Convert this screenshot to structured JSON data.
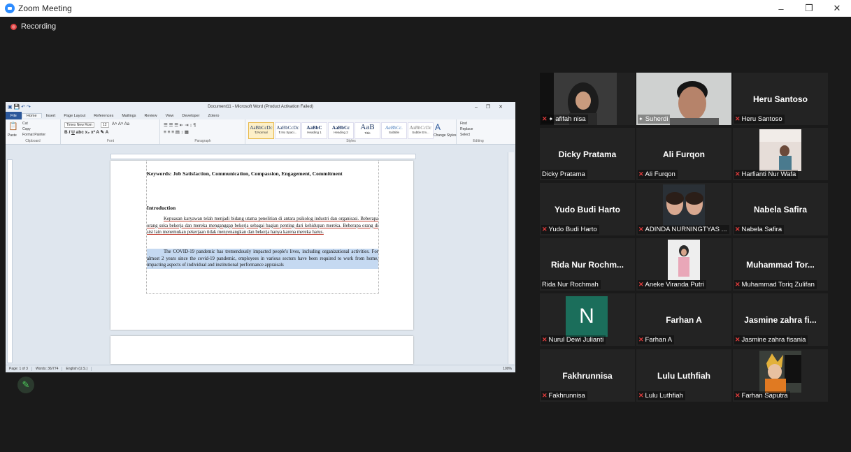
{
  "window": {
    "title": "Zoom Meeting",
    "controls": [
      "–",
      "❐",
      "✕"
    ]
  },
  "recording": {
    "label": "Recording"
  },
  "word": {
    "title": "Document11 - Microsoft Word (Product Activation Failed)",
    "tabs": [
      "File",
      "Home",
      "Insert",
      "Page Layout",
      "References",
      "Mailings",
      "Review",
      "View",
      "Developer",
      "Zotero"
    ],
    "clipboard": {
      "cut": "Cut",
      "copy": "Copy",
      "paste": "Paste",
      "format_painter": "Format Painter",
      "label": "Clipboard"
    },
    "font": {
      "name": "Times New Rom",
      "size": "12",
      "label": "Font"
    },
    "paragraph_label": "Paragraph",
    "styles": [
      {
        "preview": "AaBbCcDc",
        "name": "¶ Normal"
      },
      {
        "preview": "AaBbCcDc",
        "name": "¶ No Spaci..."
      },
      {
        "preview": "AaBbC",
        "name": "Heading 1"
      },
      {
        "preview": "AaBbCc",
        "name": "Heading 2"
      },
      {
        "preview": "AaB",
        "name": "Title"
      },
      {
        "preview": "AaBbCc.",
        "name": "Subtitle"
      },
      {
        "preview": "AaBbCcDc",
        "name": "Subtle Em..."
      }
    ],
    "styles_label": "Styles",
    "change_styles": "Change Styles",
    "editing": {
      "find": "Find",
      "replace": "Replace",
      "select": "Select",
      "label": "Editing"
    },
    "doc": {
      "keywords": "Keywords: Job Satisfaction, Communication, Compassion, Engagement, Commitment",
      "intro_heading": "Introduction",
      "para1": "Kepuasan karyawan telah menjadi bidang utama penelitian di antara psikolog industri dan organisasi. Beberapa orang suka bekerja dan mereka menganggap bekerja sebagai bagian penting dari kehidupan mereka. Beberapa orang di sisi lain menemukan pekerjaan tidak menyenangkan dan bekerja hanya karena mereka harus.",
      "para2": "The COVID-19 pandemic has tremendously impacted people's lives, including organizational activities. For almost 2 years since the covid-19 pandemic, employees in various sectors have been required to work from home, impacting aspects of individual and institutional performance appraisals"
    },
    "status": {
      "page": "Page: 1 of 3",
      "words": "Words: 36/774",
      "lang": "English (U.S.)",
      "zoom": "100%"
    }
  },
  "participants": [
    {
      "label": "afifah nisa",
      "muted": true,
      "pinned": true,
      "video": "hijab"
    },
    {
      "label": "Suherdi",
      "muted": false,
      "pinned": true,
      "video": "man",
      "speaking": true
    },
    {
      "label": "Heru Santoso",
      "name": "Heru Santoso",
      "muted": true
    },
    {
      "label": "Dicky Pratama",
      "name": "Dicky Pratama",
      "muted": false
    },
    {
      "label": "Ali Furqon",
      "name": "Ali Furqon",
      "muted": true
    },
    {
      "label": "Harfianti Nur Wafa",
      "muted": true,
      "video": "room"
    },
    {
      "label": "Yudo Budi Harto",
      "name": "Yudo Budi Harto",
      "muted": true
    },
    {
      "label": "ADINDA NURNINGTYAS ...",
      "muted": true,
      "video": "two"
    },
    {
      "label": "Nabela Safira",
      "name": "Nabela Safira",
      "muted": true
    },
    {
      "label": "Rida Nur Rochmah",
      "name": "Rida Nur Rochm...",
      "muted": false
    },
    {
      "label": "Aneke Viranda Putri",
      "muted": true,
      "video": "pink"
    },
    {
      "label": "Muhammad Toriq Zulifan",
      "name": "Muhammad Tor...",
      "muted": true
    },
    {
      "label": "Nurul Dewi Julianti",
      "muted": true,
      "avatar": "N"
    },
    {
      "label": "Farhan A",
      "name": "Farhan A",
      "muted": true
    },
    {
      "label": "Jasmine zahra fisania",
      "name": "Jasmine zahra fi...",
      "muted": true
    },
    {
      "label": "Fakhrunnisa",
      "name": "Fakhrunnisa",
      "muted": true
    },
    {
      "label": "Lulu Luthfiah",
      "name": "Lulu Luthfiah",
      "muted": true
    },
    {
      "label": "Farhan Saputra",
      "muted": true,
      "video": "anime"
    }
  ]
}
